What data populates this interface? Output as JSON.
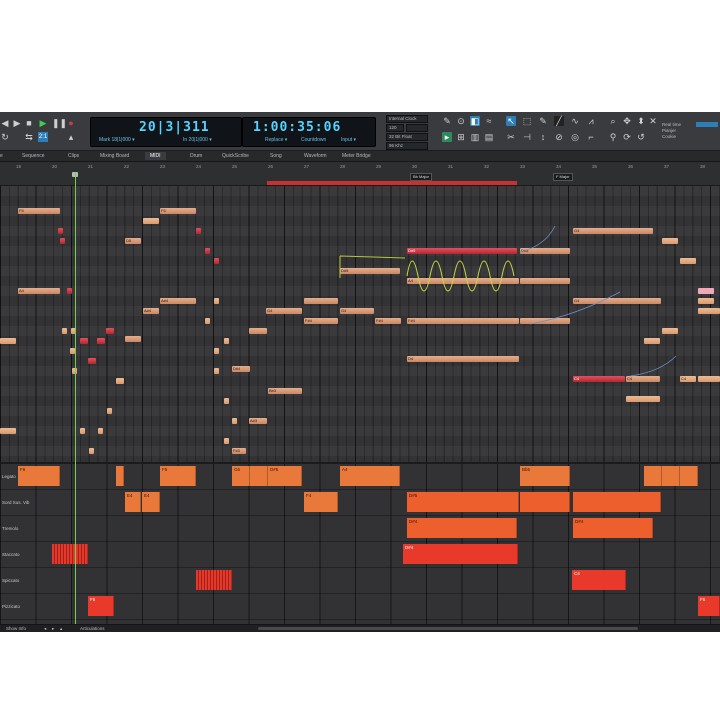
{
  "transport": {
    "counter_bars": "20|3|311",
    "counter_bars_sub_left": "Mark 18|1|000 ▾",
    "counter_bars_sub_right": "In 20|1|000 ▾",
    "counter_time": "1:00:35:06",
    "counter_time_sub_left": "Replace ▾",
    "counter_time_sub_mid": "Countdown",
    "counter_time_sub_right": "Input ▾",
    "sync_label": "Internal Clock",
    "fps_label": "120",
    "bit_label": "32 Bit Float",
    "rate_label": "96 Khz",
    "colors": {
      "counter_text": "#55d4ff",
      "play": "#3ccf52"
    }
  },
  "right_labels": {
    "line1": "Real time",
    "line2": "Pianjer",
    "line3": "Cookie"
  },
  "tabs": [
    "Sequence",
    "Clips",
    "Mixing Board",
    "MIDI",
    "Drum",
    "QuickScribe",
    "Song",
    "Waveform",
    "Meter Bridge"
  ],
  "active_tab": "MIDI",
  "ruler": {
    "numbers": [
      "19",
      "20",
      "21",
      "22",
      "23",
      "24",
      "25",
      "26",
      "27",
      "28",
      "29",
      "30",
      "31",
      "32",
      "33",
      "34",
      "35",
      "36",
      "37",
      "38"
    ],
    "markers": {
      "m1": "Bb Major",
      "m2": "F Major"
    }
  },
  "notes": {
    "n1": "F5",
    "n2": "F5",
    "n3": "D5",
    "n4": "D#5",
    "n5": "D#5",
    "n6": "D#5",
    "n7": "A4",
    "n8": "A4",
    "n9": "A#4",
    "n10": "A#4",
    "n11": "G4",
    "n12": "G4",
    "n13": "G4",
    "n14": "F#4",
    "n15": "F#4",
    "n16": "F#4",
    "n17": "D4",
    "n18": "D#4",
    "n19": "C4",
    "n20": "C4",
    "n21": "C4",
    "n22": "Bb3",
    "n23": "A#3",
    "n24": "F#3",
    "n25": "F#3",
    "n26": "G4"
  },
  "lanes": {
    "legato": "Legato",
    "sord": "Sord Sus. Vib",
    "tremolo": "Tremolo",
    "staccato": "Staccato",
    "spiccato": "Spiccato",
    "pizzicato": "Pizzicato"
  },
  "lane_notes": {
    "l1": "F6",
    "l2": "G6",
    "l3": "F5",
    "l4": "F4",
    "l5": "D#5",
    "l6": "A4",
    "l7": "D#5",
    "l8": "Bb5",
    "l9": "E4",
    "l10": "E4",
    "l11": "F4",
    "l12": "D#5",
    "l13": "D#4",
    "l14": "D#4",
    "l15": "D#4",
    "l16": "C4",
    "l17": "C4",
    "l18": "F5",
    "l19": "F5"
  },
  "status": {
    "show_info": "Show Info",
    "articulations": "Articulations"
  }
}
